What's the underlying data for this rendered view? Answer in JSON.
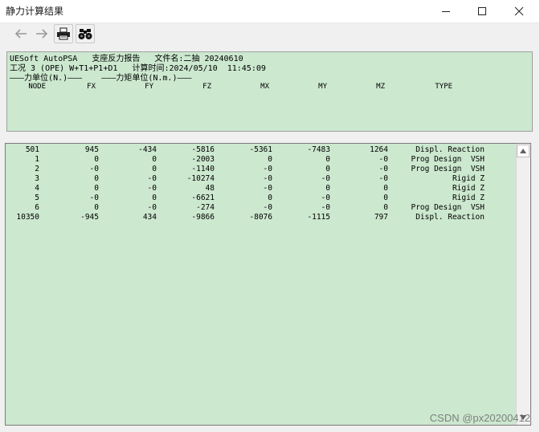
{
  "window": {
    "title": "静力计算结果",
    "minimize": "—",
    "maximize": "☐",
    "close": "✕"
  },
  "toolbar": {
    "buttons": [
      {
        "name": "back",
        "icon": "arrow-left-icon"
      },
      {
        "name": "forward",
        "icon": "arrow-right-icon"
      },
      {
        "name": "print",
        "icon": "printer-icon"
      },
      {
        "name": "find",
        "icon": "binoculars-icon"
      }
    ]
  },
  "report": {
    "line1": "UESoft AutoPSA   支座反力报告   文件名:二抽 20240610",
    "line2": "工况 3 (OPE) W+T1+P1+D1   计算时间:2024/05/10  11:45:09",
    "line3": "———力单位(N.)———    ———力矩单位(N.m.)———",
    "columns": [
      "NODE",
      "FX",
      "FY",
      "FZ",
      "MX",
      "MY",
      "MZ",
      "TYPE"
    ]
  },
  "rows": [
    {
      "node": "501",
      "fx": "945",
      "fy": "-434",
      "fz": "-5816",
      "mx": "-5361",
      "my": "-7483",
      "mz": "1264",
      "type": "Displ. Reaction"
    },
    {
      "node": "1",
      "fx": "0",
      "fy": "0",
      "fz": "-2003",
      "mx": "0",
      "my": "0",
      "mz": "-0",
      "type": "Prog Design  VSH"
    },
    {
      "node": "2",
      "fx": "-0",
      "fy": "0",
      "fz": "-1140",
      "mx": "-0",
      "my": "0",
      "mz": "-0",
      "type": "Prog Design  VSH"
    },
    {
      "node": "3",
      "fx": "0",
      "fy": "-0",
      "fz": "-10274",
      "mx": "-0",
      "my": "-0",
      "mz": "-0",
      "type": "Rigid Z"
    },
    {
      "node": "4",
      "fx": "0",
      "fy": "-0",
      "fz": "48",
      "mx": "-0",
      "my": "0",
      "mz": "0",
      "type": "Rigid Z"
    },
    {
      "node": "5",
      "fx": "-0",
      "fy": "0",
      "fz": "-6621",
      "mx": "0",
      "my": "-0",
      "mz": "0",
      "type": "Rigid Z"
    },
    {
      "node": "6",
      "fx": "0",
      "fy": "-0",
      "fz": "-274",
      "mx": "-0",
      "my": "-0",
      "mz": "0",
      "type": "Prog Design  VSH"
    },
    {
      "node": "10350",
      "fx": "-945",
      "fy": "434",
      "fz": "-9866",
      "mx": "-8076",
      "my": "-1115",
      "mz": "797",
      "type": "Displ. Reaction"
    }
  ],
  "watermark": "CSDN @px20200412",
  "colors": {
    "panel_bg": "#cce8cf",
    "window_bg": "#f0f0f0"
  }
}
